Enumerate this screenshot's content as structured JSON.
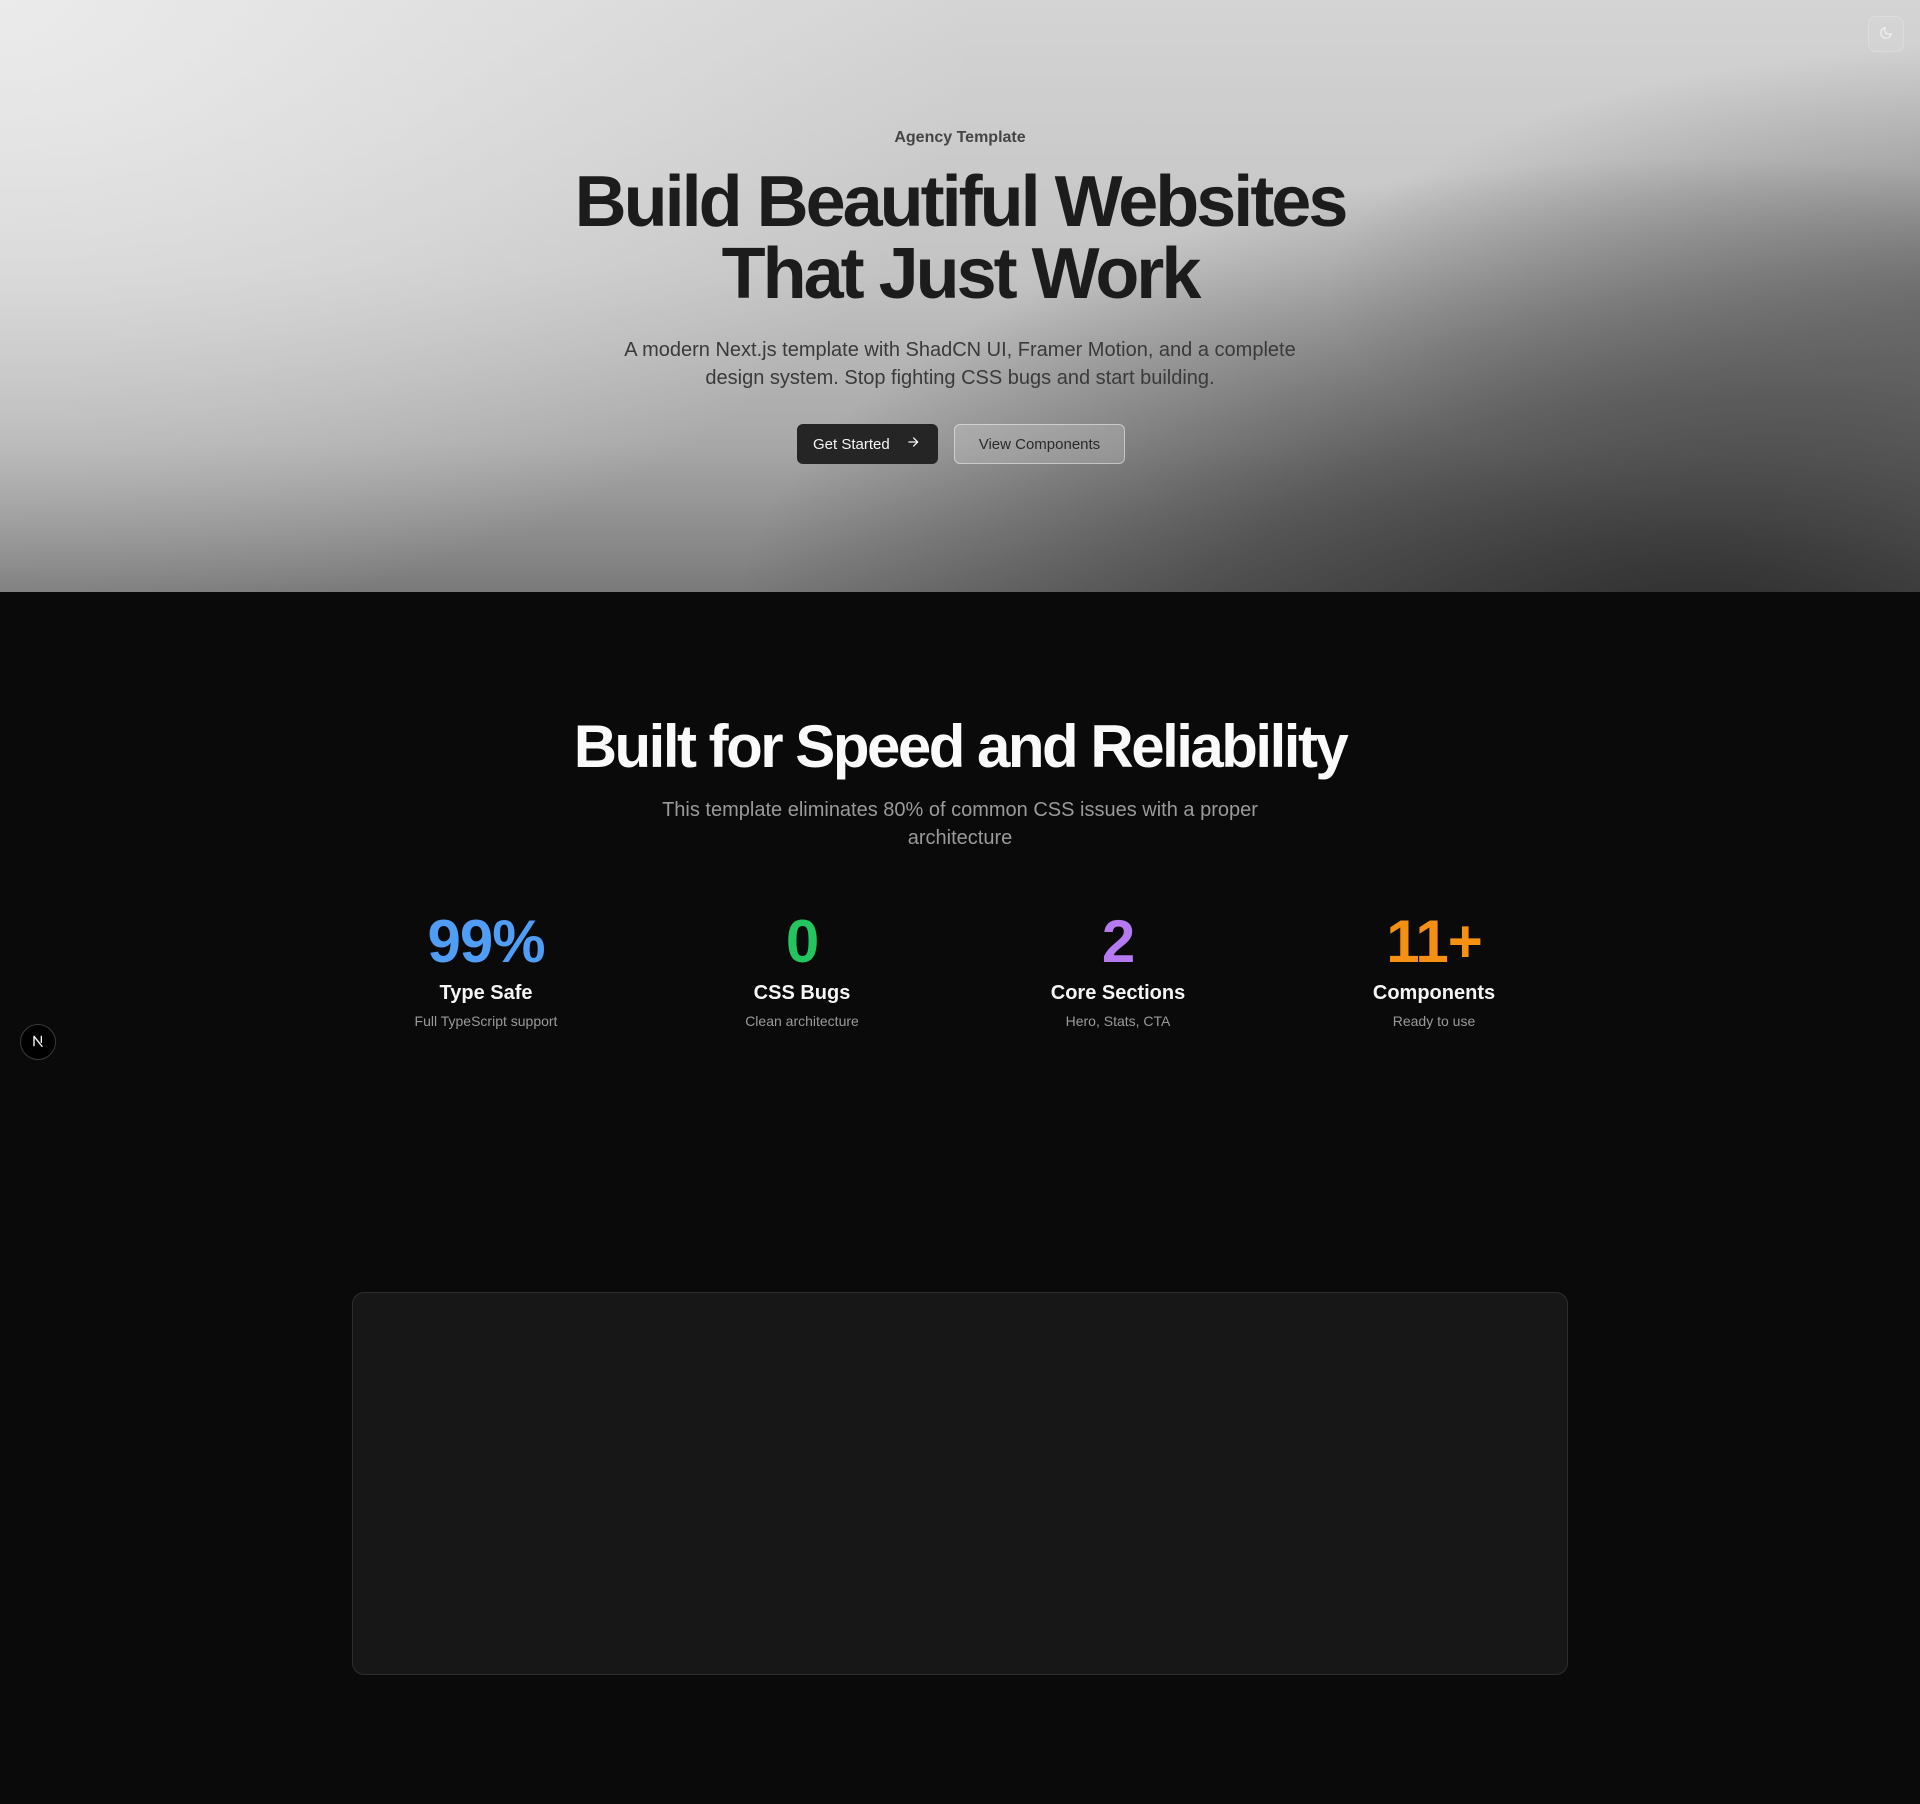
{
  "hero": {
    "eyebrow": "Agency Template",
    "headline_line1": "Build Beautiful Websites",
    "headline_line2": "That Just Work",
    "subhead": "A modern Next.js template with ShadCN UI, Framer Motion, and a complete design system. Stop fighting CSS bugs and start building.",
    "primary_cta": "Get Started",
    "secondary_cta": "View Components",
    "primary_cta_icon": "arrow-right-icon",
    "theme_toggle_icon": "moon-icon"
  },
  "stats": {
    "title": "Built for Speed and Reliability",
    "subtitle": "This template eliminates 80% of common CSS issues with a proper architecture",
    "items": [
      {
        "value": "99%",
        "label": "Type Safe",
        "description": "Full TypeScript support",
        "color": "#4f9df5"
      },
      {
        "value": "0",
        "label": "CSS Bugs",
        "description": "Clean architecture",
        "color": "#22c55e"
      },
      {
        "value": "2",
        "label": "Core Sections",
        "description": "Hero, Stats, CTA",
        "color": "#b57af0"
      },
      {
        "value": "11+",
        "label": "Components",
        "description": "Ready to use",
        "color": "#f59012"
      }
    ]
  },
  "overlay": {
    "next_badge_icon": "nextjs-logo-icon",
    "next_badge_letter": "N"
  }
}
